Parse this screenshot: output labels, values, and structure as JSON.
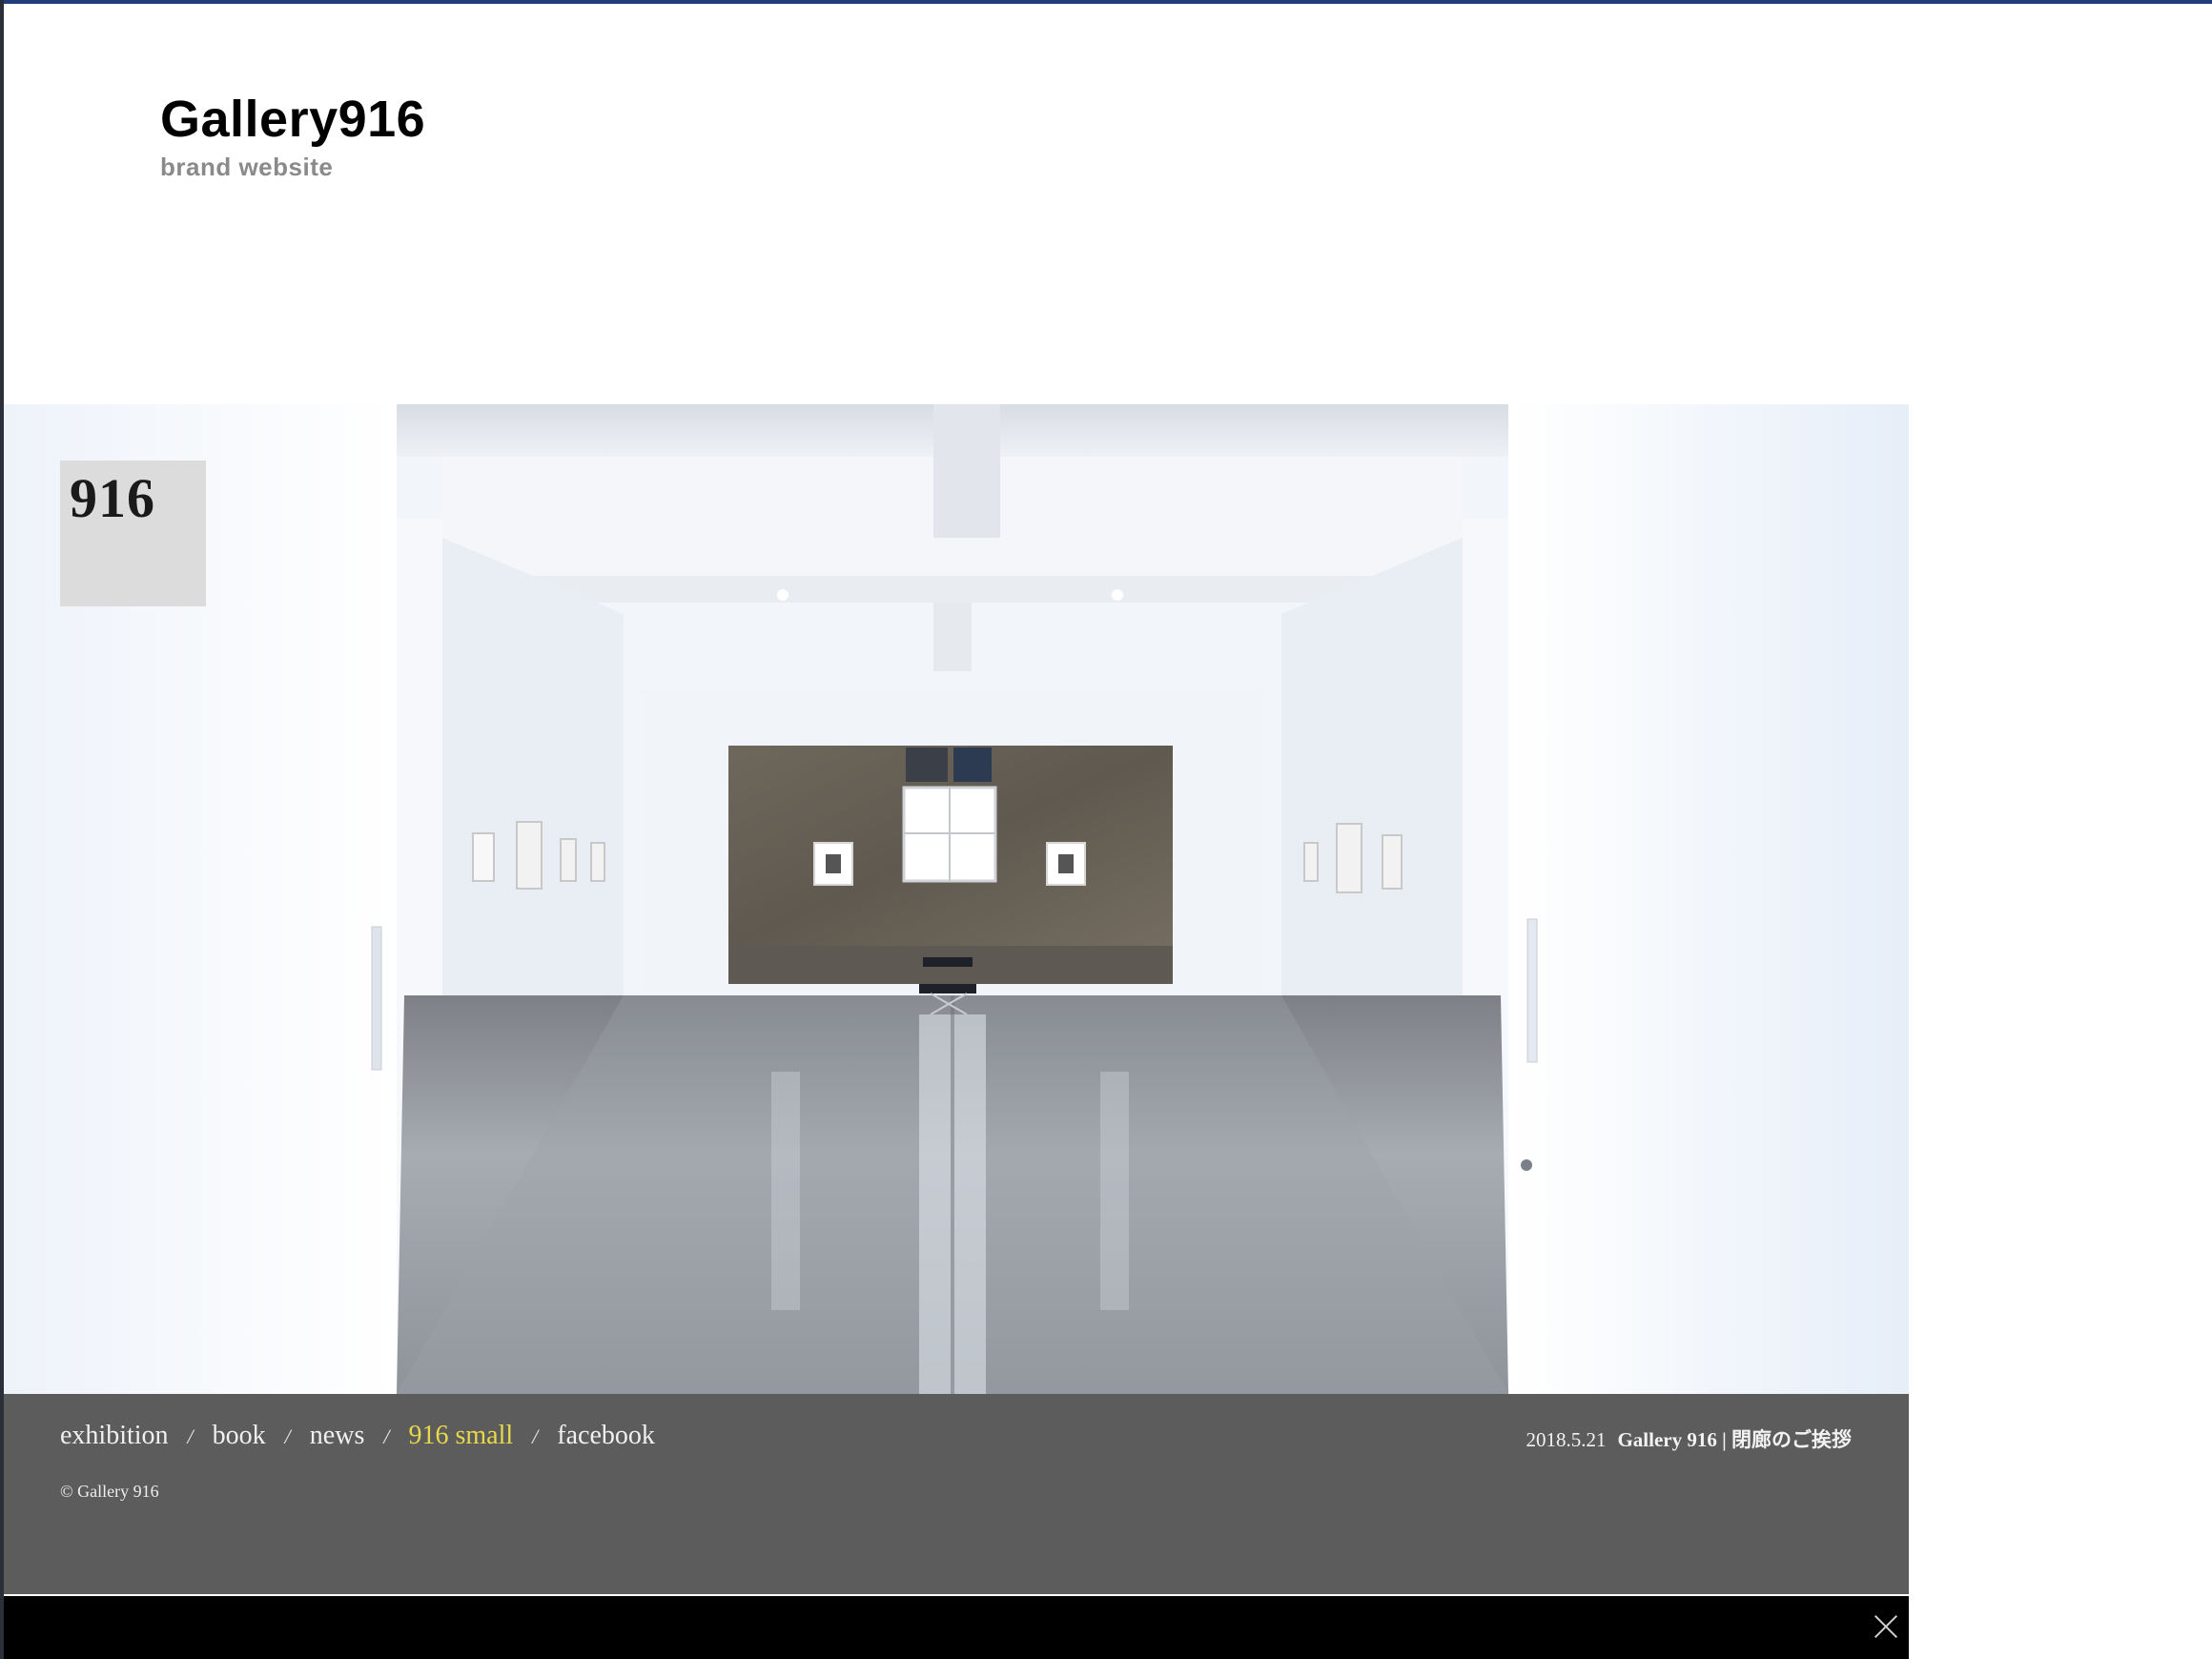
{
  "brand": {
    "title": "Gallery916",
    "subtitle": "brand website"
  },
  "hero": {
    "image": "gallery-interior-photo",
    "logo_text": "916"
  },
  "footer": {
    "nav": [
      {
        "label": "exhibition",
        "active": false
      },
      {
        "label": "book",
        "active": false
      },
      {
        "label": "news",
        "active": false
      },
      {
        "label": "916 small",
        "active": true
      },
      {
        "label": "facebook",
        "active": false
      }
    ],
    "separator": "/",
    "copyright": "© Gallery 916",
    "news": {
      "date": "2018.5.21",
      "title": "Gallery 916 | 閉廊のご挨拶"
    }
  },
  "colors": {
    "footer_bg": "#5c5c5c",
    "active_link": "#e8d84a",
    "top_border": "#1f3d7a"
  },
  "icons": {
    "close": "close-icon"
  }
}
